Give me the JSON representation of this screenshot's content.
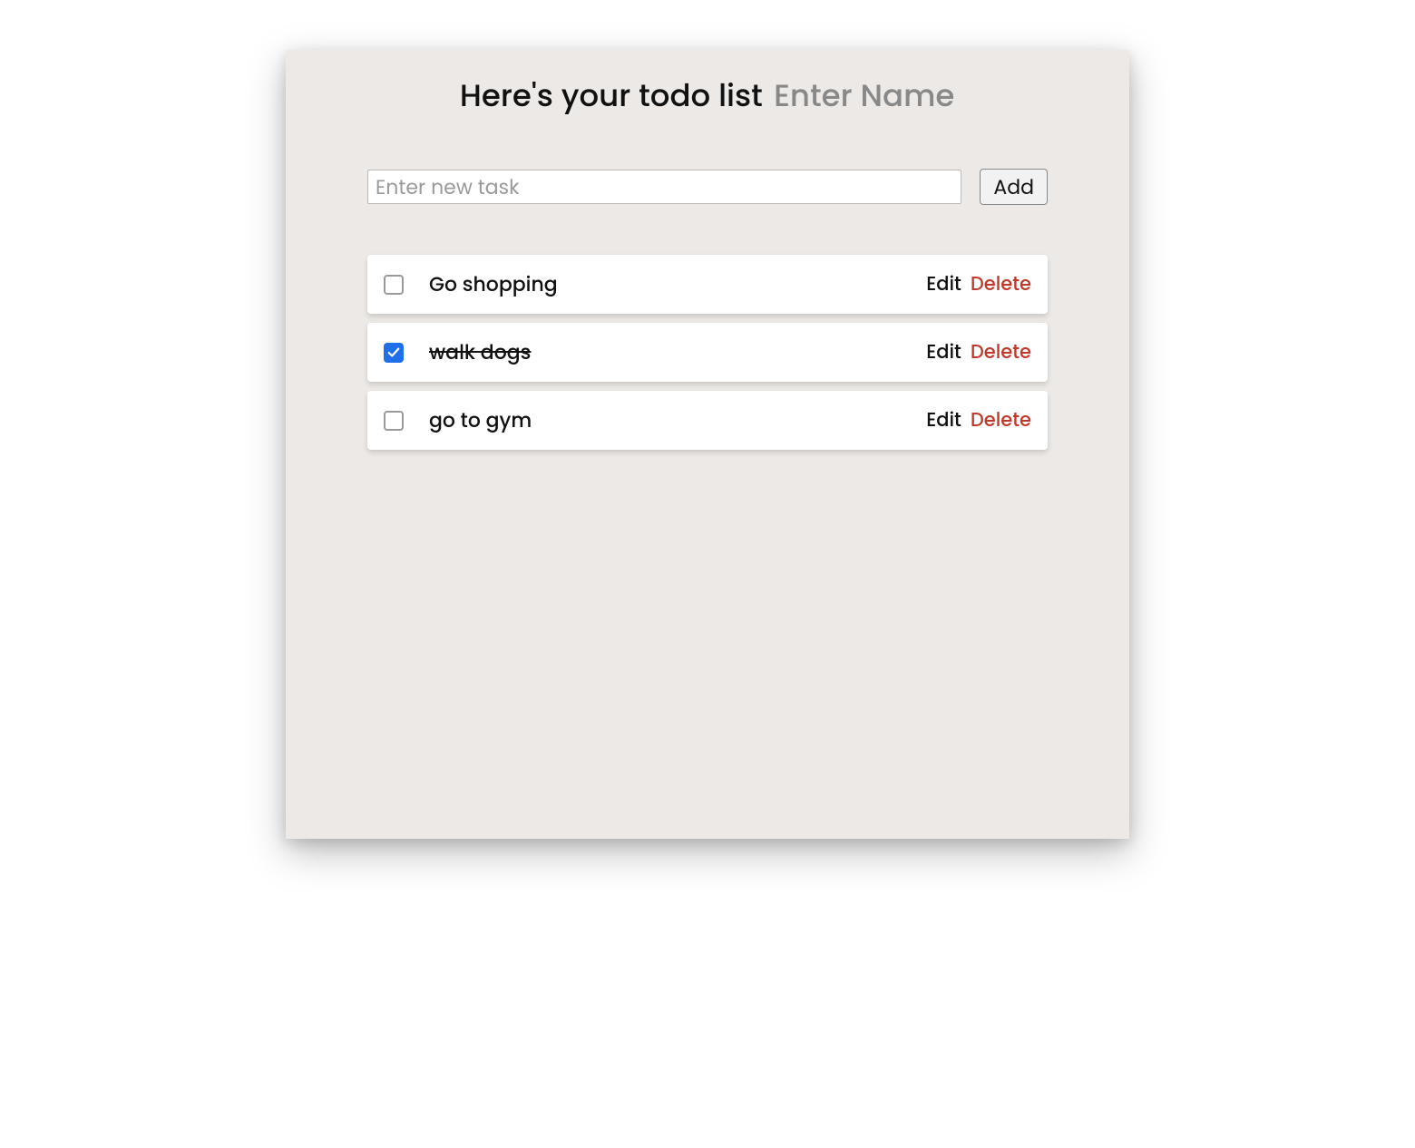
{
  "header": {
    "title": "Here's your todo list",
    "name_placeholder": "Enter Name",
    "name_value": ""
  },
  "input": {
    "placeholder": "Enter new task",
    "value": "",
    "add_label": "Add"
  },
  "actions": {
    "edit_label": "Edit",
    "delete_label": "Delete"
  },
  "tasks": [
    {
      "label": "Go shopping",
      "completed": false
    },
    {
      "label": "walk dogs",
      "completed": true
    },
    {
      "label": "go to gym",
      "completed": false
    }
  ]
}
